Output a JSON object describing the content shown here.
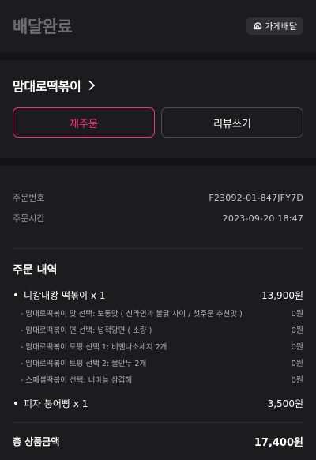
{
  "header": {
    "title": "배달완료",
    "type_badge": {
      "label": "가게배달",
      "icon": "delivery-helmet-icon"
    }
  },
  "store": {
    "name": "맘대로떡볶이",
    "chevron_icon": "chevron-right-icon",
    "reorder_label": "재주문",
    "review_label": "리뷰쓰기"
  },
  "meta": {
    "order_number_label": "주문번호",
    "order_number_value": "F23092-01-847JFY7D",
    "order_time_label": "주문시간",
    "order_time_value": "2023-09-20 18:47"
  },
  "order": {
    "title": "주문 내역",
    "items": [
      {
        "name": "니캉내캉 떡볶이 x 1",
        "price": "13,900원",
        "options": [
          {
            "name": "- 맘대로떡볶이 맛 선택: 보통맛 ( 신라면과 불닭 사이 / 첫주문 추천맛 )",
            "price": "0원"
          },
          {
            "name": "- 맘대로떡볶이 면 선택: 넙적당면 ( 소량 )",
            "price": "0원"
          },
          {
            "name": "- 맘대로떡볶이 토핑 선택 1: 비엔나소세지 2개",
            "price": "0원"
          },
          {
            "name": "- 맘대로떡볶이 토핑 선택 2: 물만두 2개",
            "price": "0원"
          },
          {
            "name": "- 스페셜떡볶이 선택: 너마늘 삼겹해",
            "price": "0원"
          }
        ]
      },
      {
        "name": "피자 붕어빵 x 1",
        "price": "3,500원",
        "options": []
      }
    ]
  },
  "total": {
    "label": "총 상품금액",
    "value": "17,400원"
  },
  "colors": {
    "background": "#1c1c1e",
    "accent": "#ff2d7a",
    "muted_title": "#6e6e72"
  }
}
